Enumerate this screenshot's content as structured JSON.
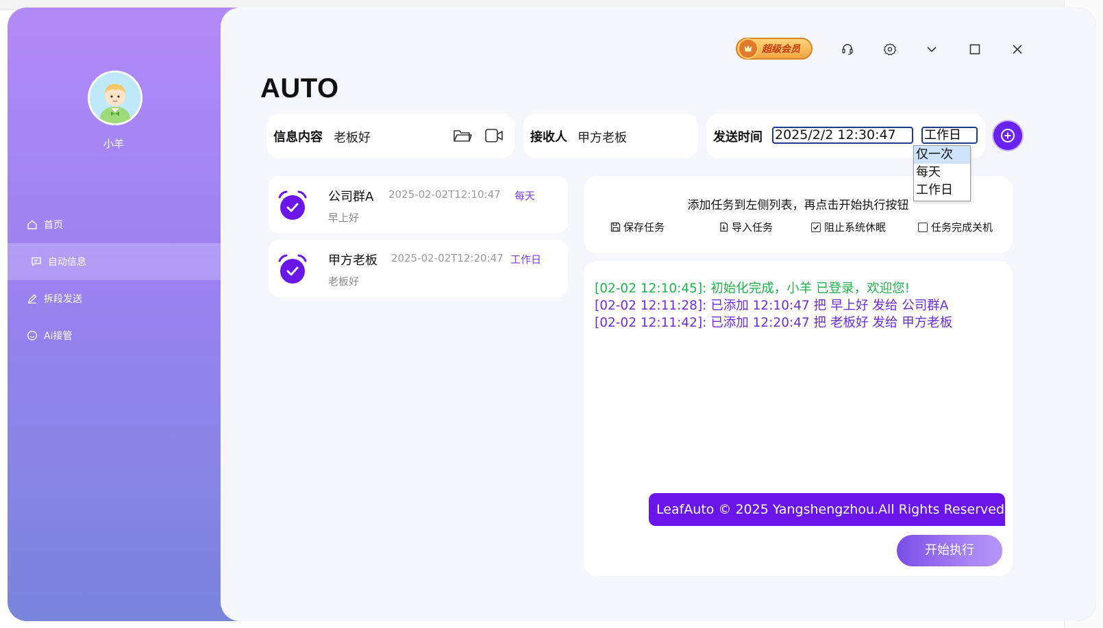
{
  "app": {
    "title": "AUTO",
    "user": {
      "name": "小羊"
    },
    "vip_label": "超级会员"
  },
  "sidebar": {
    "items": [
      {
        "label": "首页",
        "icon": "home-icon"
      },
      {
        "label": "自动信息",
        "icon": "message-icon",
        "active": true
      },
      {
        "label": "拆段发送",
        "icon": "edit-icon"
      },
      {
        "label": "Ai接管",
        "icon": "smile-icon"
      }
    ]
  },
  "form": {
    "content_label": "信息内容",
    "content_value": "老板好",
    "recipient_label": "接收人",
    "recipient_value": "甲方老板",
    "time_label": "发送时间",
    "time_value": "2025/2/2 12:30:47",
    "frequency_value": "工作日",
    "frequency_options": [
      "仅一次",
      "每天",
      "工作日"
    ],
    "frequency_highlighted": "仅一次"
  },
  "tasks": [
    {
      "name": "公司群A",
      "time": "2025-02-02T12:10:47",
      "freq": "每天",
      "message": "早上好"
    },
    {
      "name": "甲方老板",
      "time": "2025-02-02T12:20:47",
      "freq": "工作日",
      "message": "老板好"
    }
  ],
  "options": {
    "hint": "添加任务到左侧列表，再点击开始执行按钮",
    "save_label": "保存任务",
    "import_label": "导入任务",
    "prevent_sleep_label": "阻止系统休眠",
    "prevent_sleep_checked": true,
    "shutdown_label": "任务完成关机",
    "shutdown_checked": false
  },
  "log": [
    {
      "text": "[02-02 12:10:45]: 初始化完成，小羊 已登录，欢迎您!",
      "color": "#22b14c"
    },
    {
      "text": "[02-02 12:11:28]: 已添加 12:10:47 把 早上好 发给 公司群A",
      "color": "#6a2fd6"
    },
    {
      "text": "[02-02 12:11:42]: 已添加 12:20:47 把 老板好 发给 甲方老板",
      "color": "#6a2fd6"
    }
  ],
  "copyright": "LeafAuto © 2025 Yangshengzhou.All Rights Reserved",
  "start_label": "开始执行",
  "colors": {
    "accent": "#6a16e8",
    "sidebar_top": "#b18af7",
    "sidebar_bottom": "#7a85dc"
  }
}
